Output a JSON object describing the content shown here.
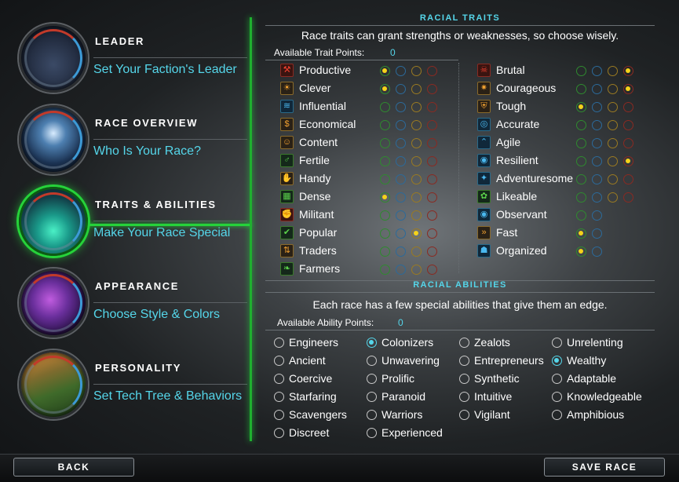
{
  "steps": [
    {
      "title": "Leader",
      "subtitle": "Set Your Faction's Leader"
    },
    {
      "title": "Race Overview",
      "subtitle": "Who Is Your Race?"
    },
    {
      "title": "Traits & Abilities",
      "subtitle": "Make Your Race Special"
    },
    {
      "title": "Appearance",
      "subtitle": "Choose Style & Colors"
    },
    {
      "title": "Personality",
      "subtitle": "Set Tech Tree & Behaviors"
    }
  ],
  "active_step": "Traits & Abilities",
  "traits": {
    "header": "Racial Traits",
    "description": "Race traits can grant strengths or weaknesses, so choose wisely.",
    "points_label": "Available Trait Points:",
    "points_value": "0",
    "left": [
      {
        "name": "Productive",
        "icon": "hammer-icon",
        "levels": 4,
        "selected": 0
      },
      {
        "name": "Clever",
        "icon": "lightbulb-icon",
        "levels": 4,
        "selected": 0
      },
      {
        "name": "Influential",
        "icon": "influence-icon",
        "levels": 4,
        "selected": null
      },
      {
        "name": "Economical",
        "icon": "coins-icon",
        "levels": 4,
        "selected": null
      },
      {
        "name": "Content",
        "icon": "smile-icon",
        "levels": 4,
        "selected": null
      },
      {
        "name": "Fertile",
        "icon": "family-icon",
        "levels": 4,
        "selected": null
      },
      {
        "name": "Handy",
        "icon": "hand-icon",
        "levels": 4,
        "selected": null
      },
      {
        "name": "Dense",
        "icon": "grid-icon",
        "levels": 4,
        "selected": 0
      },
      {
        "name": "Militant",
        "icon": "fist-icon",
        "levels": 4,
        "selected": null
      },
      {
        "name": "Popular",
        "icon": "thumbs-up-icon",
        "levels": 4,
        "selected": 2
      },
      {
        "name": "Traders",
        "icon": "trade-icon",
        "levels": 4,
        "selected": null
      },
      {
        "name": "Farmers",
        "icon": "leaf-icon",
        "levels": 4,
        "selected": null
      }
    ],
    "right": [
      {
        "name": "Brutal",
        "icon": "skull-icon",
        "levels": 4,
        "selected": 3
      },
      {
        "name": "Courageous",
        "icon": "flame-icon",
        "levels": 4,
        "selected": 3
      },
      {
        "name": "Tough",
        "icon": "shield-icon",
        "levels": 4,
        "selected": 0
      },
      {
        "name": "Accurate",
        "icon": "target-icon",
        "levels": 4,
        "selected": null
      },
      {
        "name": "Agile",
        "icon": "chevrons-up-icon",
        "levels": 4,
        "selected": null
      },
      {
        "name": "Resilient",
        "icon": "circle-shield-icon",
        "levels": 4,
        "selected": 3
      },
      {
        "name": "Adventuresome",
        "icon": "compass-icon",
        "levels": 4,
        "selected": null
      },
      {
        "name": "Likeable",
        "icon": "handshake-icon",
        "levels": 4,
        "selected": null
      },
      {
        "name": "Observant",
        "icon": "eye-icon",
        "levels": 2,
        "selected": null
      },
      {
        "name": "Fast",
        "icon": "fast-forward-icon",
        "levels": 2,
        "selected": 0
      },
      {
        "name": "Organized",
        "icon": "people-icon",
        "levels": 2,
        "selected": 0
      }
    ]
  },
  "abilities": {
    "header": "Racial Abilities",
    "description": "Each race has a few special abilities that give them an edge.",
    "points_label": "Available Ability Points:",
    "points_value": "0",
    "columns": [
      [
        "Engineers",
        "Ancient",
        "Coercive",
        "Starfaring",
        "Scavengers",
        "Discreet"
      ],
      [
        "Colonizers",
        "Unwavering",
        "Prolific",
        "Paranoid",
        "Warriors",
        "Experienced"
      ],
      [
        "Zealots",
        "Entrepreneurs",
        "Synthetic",
        "Intuitive",
        "Vigilant"
      ],
      [
        "Unrelenting",
        "Wealthy",
        "Adaptable",
        "Knowledgeable",
        "Amphibious"
      ]
    ],
    "selected": [
      "Colonizers",
      "Wealthy"
    ]
  },
  "buttons": {
    "back": "Back",
    "save": "Save Race"
  },
  "colors": {
    "accent_green": "#26d23a",
    "accent_cyan": "#55d6ea",
    "selected_dot": "#f5d21a"
  }
}
